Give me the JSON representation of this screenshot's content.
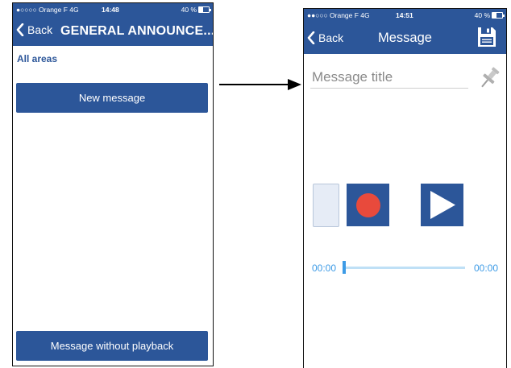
{
  "screen_left": {
    "status": {
      "carrier": "●○○○○ Orange F  4G",
      "time": "14:48",
      "battery": "40 %"
    },
    "nav": {
      "back_label": "Back",
      "title": "GENERAL ANNOUNCE..."
    },
    "area_label": "All areas",
    "new_message_button": "New message",
    "no_playback_button": "Message without playback"
  },
  "screen_right": {
    "status": {
      "carrier": "●●○○○ Orange F  4G",
      "time": "14:51",
      "battery": "40 %"
    },
    "nav": {
      "back_label": "Back",
      "title": "Message"
    },
    "title_input": {
      "placeholder": "Message title",
      "value": ""
    },
    "player": {
      "time_start": "00:00",
      "time_end": "00:00",
      "progress": 0
    }
  },
  "colors": {
    "navbar": "#2c5699",
    "accent": "#3d9be6",
    "record": "#e84a3c"
  },
  "icons": [
    "chevron-left-icon",
    "save-icon",
    "pin-icon",
    "record-icon",
    "play-icon",
    "arrow-right-icon"
  ]
}
